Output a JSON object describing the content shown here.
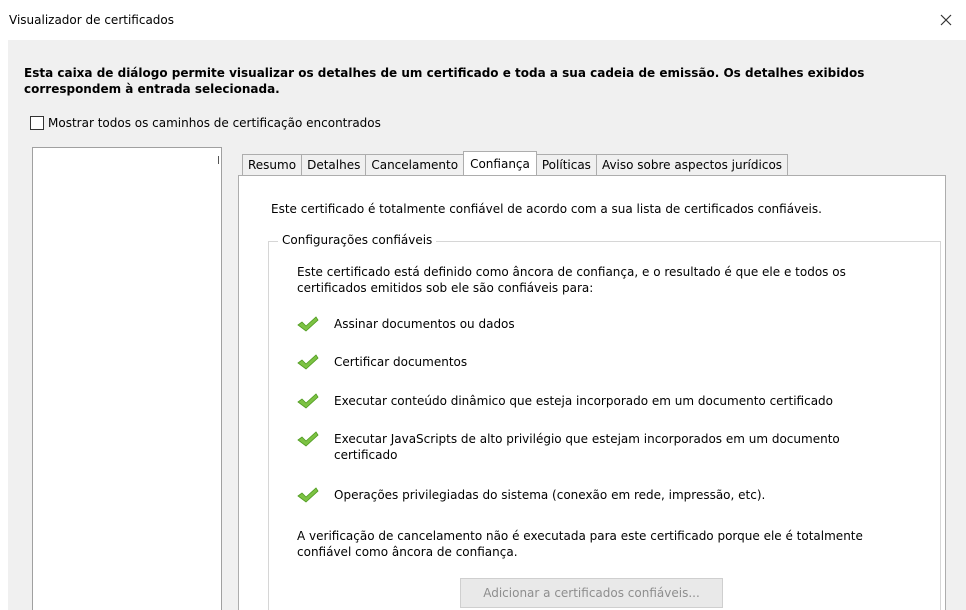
{
  "window": {
    "title": "Visualizador de certificados",
    "close_icon": "close-icon"
  },
  "description": "Esta caixa de diálogo permite visualizar os detalhes de um certificado e toda a sua cadeia de emissão. Os detalhes exibidos correspondem à entrada selecionada.",
  "show_all_paths": {
    "label": "Mostrar todos os caminhos de certificação encontrados",
    "checked": false
  },
  "tabs": [
    {
      "label": "Resumo",
      "active": false
    },
    {
      "label": "Detalhes",
      "active": false
    },
    {
      "label": "Cancelamento",
      "active": false
    },
    {
      "label": "Confiança",
      "active": true
    },
    {
      "label": "Políticas",
      "active": false
    },
    {
      "label": "Aviso sobre aspectos jurídicos",
      "active": false
    }
  ],
  "trust": {
    "summary": "Este certificado é totalmente confiável de acordo com a sua lista de certificados confiáveis.",
    "group_title": "Configurações confiáveis",
    "intro": "Este certificado está definido como âncora de confiança, e o resultado é que ele e todos os certificados emitidos sob ele são confiáveis para:",
    "permissions": [
      {
        "label": "Assinar documentos ou dados",
        "icon": "checkmark-icon"
      },
      {
        "label": "Certificar documentos",
        "icon": "checkmark-icon"
      },
      {
        "label": "Executar conteúdo dinâmico que esteja incorporado em um documento certificado",
        "icon": "checkmark-icon"
      },
      {
        "label": "Executar JavaScripts de alto privilégio que estejam incorporados em um documento certificado",
        "icon": "checkmark-icon"
      },
      {
        "label": "Operações privilegiadas do sistema (conexão em rede, impressão, etc).",
        "icon": "checkmark-icon"
      }
    ],
    "revocation_note": "A verificação de cancelamento não é executada para este certificado porque ele é totalmente confiável como âncora de confiança.",
    "add_button": "Adicionar a certificados confiáveis..."
  },
  "colors": {
    "check_green": "#7cc243",
    "check_green_dark": "#4e9a1f",
    "disabled_text": "#8e8e8e"
  }
}
